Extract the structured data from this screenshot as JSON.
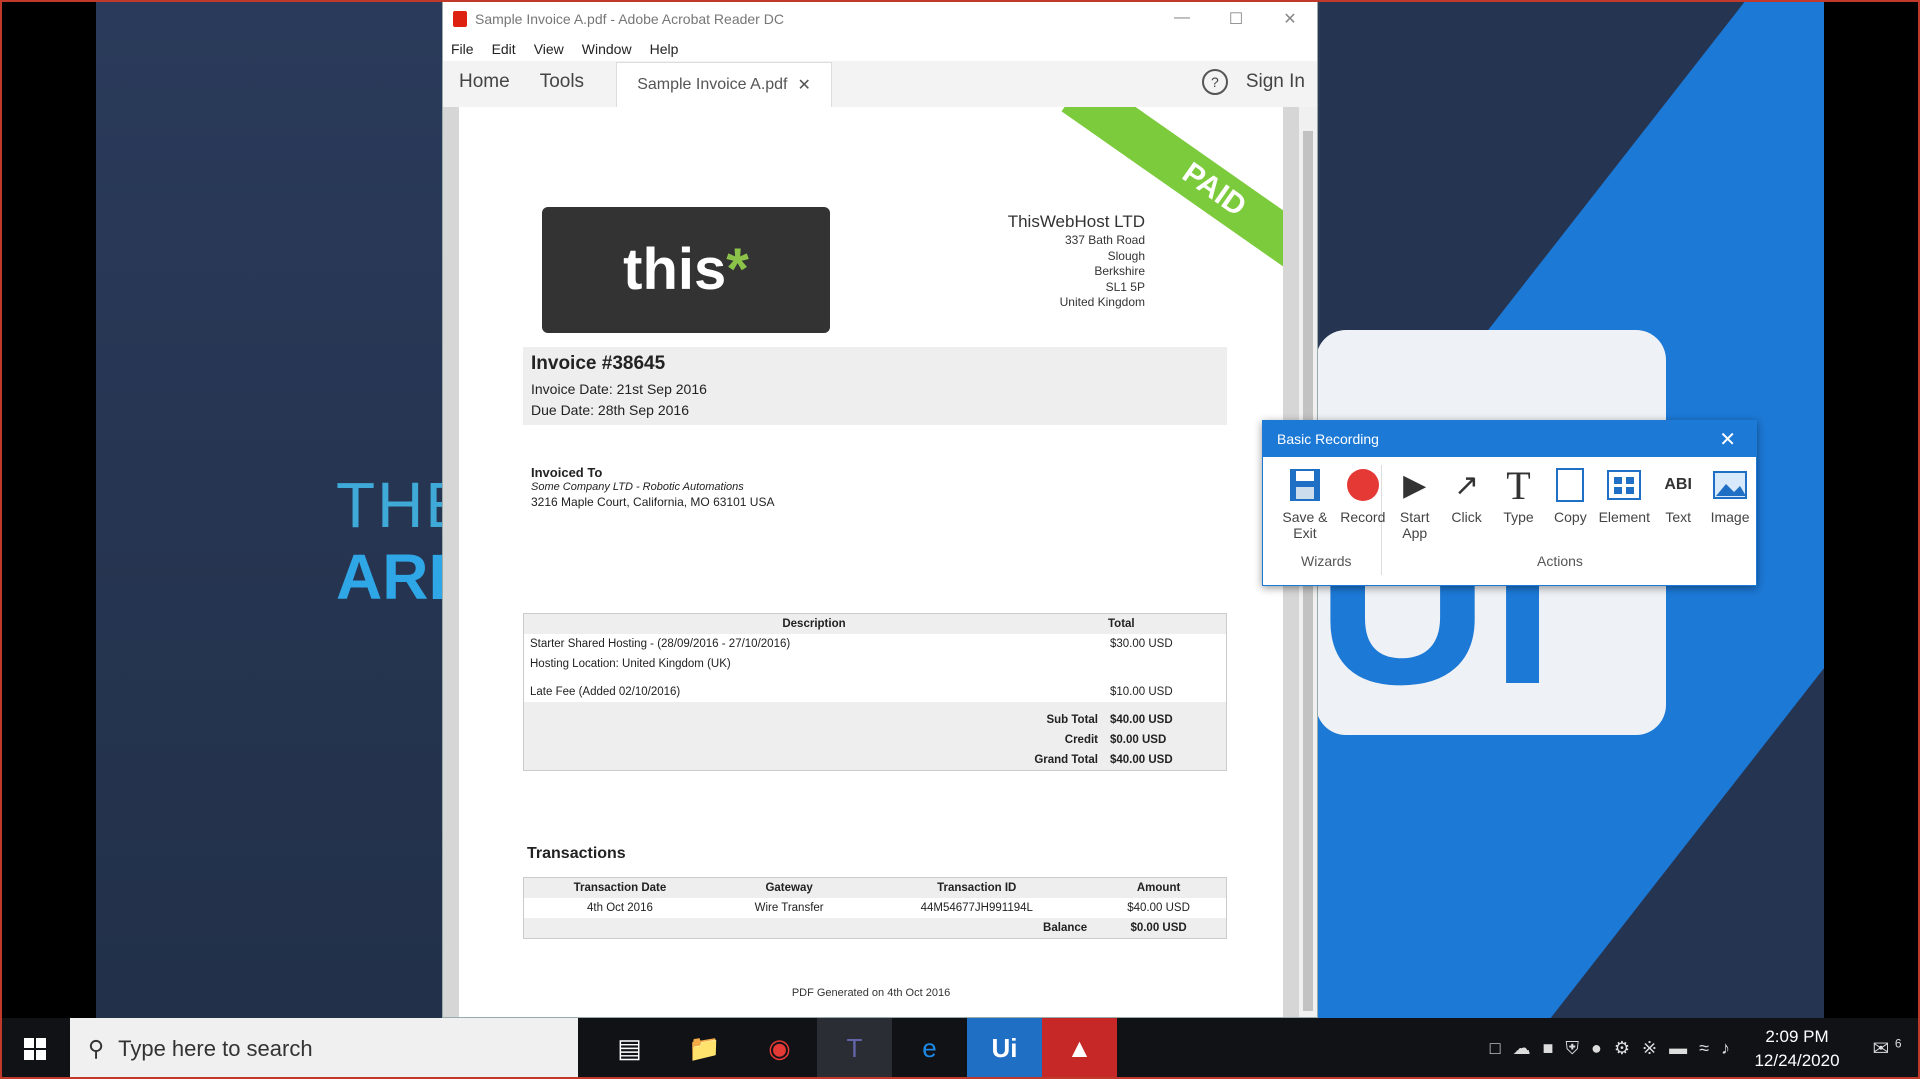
{
  "desktop": {
    "text_the": "THE",
    "text_ari": "ARI"
  },
  "acrobat": {
    "window_title": "Sample Invoice A.pdf - Adobe Acrobat Reader DC",
    "menu": [
      "File",
      "Edit",
      "View",
      "Window",
      "Help"
    ],
    "nav_home": "Home",
    "nav_tools": "Tools",
    "doc_tab": "Sample Invoice A.pdf",
    "help_glyph": "?",
    "sign_in": "Sign In"
  },
  "invoice": {
    "stamp": "PAID",
    "logo_text": "this",
    "logo_star": "*",
    "company_name": "ThisWebHost LTD",
    "address": [
      "337 Bath Road",
      "Slough",
      "Berkshire",
      "SL1 5P",
      "United Kingdom"
    ],
    "number": "Invoice #38645",
    "invoice_date": "Invoice Date: 21st Sep 2016",
    "due_date": "Due Date: 28th Sep 2016",
    "invoiced_to_label": "Invoiced To",
    "invoiced_to_company": "Some Company LTD - Robotic Automations",
    "invoiced_to_address": "3216 Maple Court,   California, MO 63101 USA",
    "items_headers": [
      "Description",
      "Total"
    ],
    "items": [
      {
        "desc": "Starter Shared Hosting - (28/09/2016 - 27/10/2016)",
        "total": "$30.00 USD"
      },
      {
        "desc": "Hosting Location: United Kingdom (UK)",
        "total": ""
      },
      {
        "desc": "Late Fee (Added 02/10/2016)",
        "total": "$10.00 USD"
      }
    ],
    "summary": [
      {
        "label": "Sub Total",
        "value": "$40.00 USD"
      },
      {
        "label": "Credit",
        "value": "$0.00 USD"
      },
      {
        "label": "Grand Total",
        "value": "$40.00 USD"
      }
    ],
    "transactions_title": "Transactions",
    "trans_headers": [
      "Transaction Date",
      "Gateway",
      "Transaction ID",
      "Amount"
    ],
    "trans_row": [
      "4th Oct 2016",
      "Wire Transfer",
      "44M54677JH991194L",
      "$40.00 USD"
    ],
    "balance_label": "Balance",
    "balance_value": "$0.00 USD",
    "footer": "PDF Generated on 4th Oct 2016"
  },
  "recording": {
    "title": "Basic Recording",
    "tools": [
      {
        "icon": "save-icon",
        "label": "Save & Exit"
      },
      {
        "icon": "record-icon",
        "label": "Record"
      },
      {
        "icon": "start-app-icon",
        "label": "Start App"
      },
      {
        "icon": "click-icon",
        "label": "Click"
      },
      {
        "icon": "type-icon",
        "label": "Type"
      },
      {
        "icon": "copy-icon",
        "label": "Copy"
      },
      {
        "icon": "element-icon",
        "label": "Element"
      },
      {
        "icon": "text-icon",
        "label": "Text"
      },
      {
        "icon": "image-icon",
        "label": "Image"
      }
    ],
    "group_wizards": "Wizards",
    "group_actions": "Actions"
  },
  "taskbar": {
    "search_placeholder": "Type here to search",
    "time": "2:09 PM",
    "date": "12/24/2020",
    "notification_count": "6"
  }
}
